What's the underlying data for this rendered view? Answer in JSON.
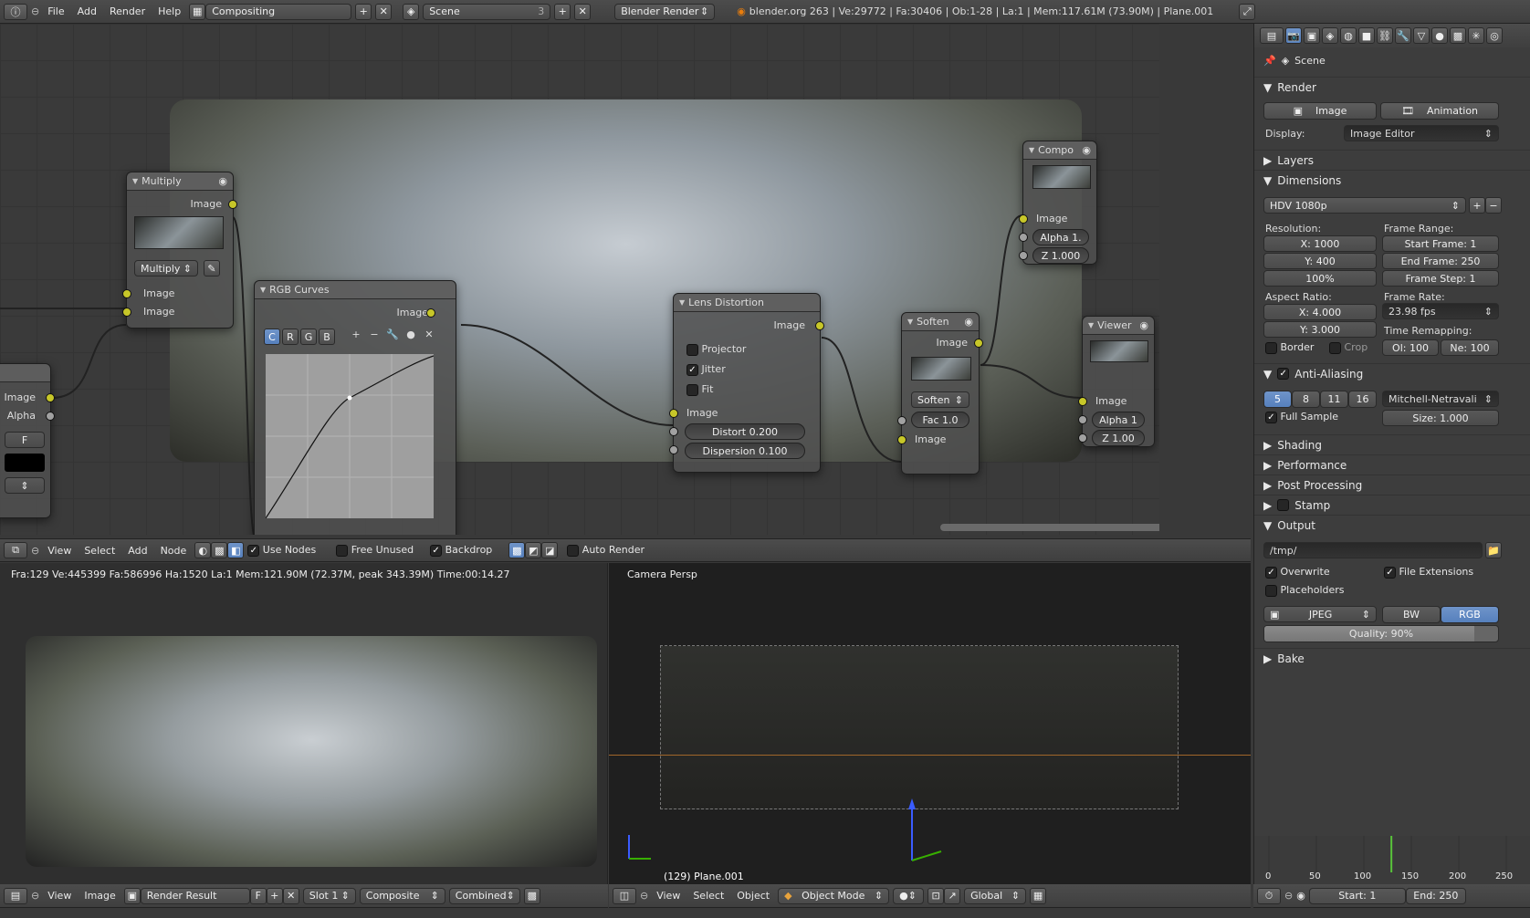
{
  "topbar": {
    "menus": [
      "File",
      "Add",
      "Render",
      "Help"
    ],
    "screen": "Compositing",
    "scene": "Scene",
    "scene_users": "3",
    "engine": "Blender Render",
    "stats": "blender.org 263 | Ve:29772 | Fa:30406 | Ob:1-28 | La:1 | Mem:117.61M (73.90M) | Plane.001"
  },
  "nodes": {
    "multiply": {
      "title": "Multiply",
      "out": "Image",
      "blend": "Multiply",
      "in1": "Image",
      "in2": "Image"
    },
    "left": {
      "out1": "Image",
      "out2": "Alpha",
      "f": "F"
    },
    "curves": {
      "title": "RGB Curves",
      "out": "Image",
      "tabs": [
        "C",
        "R",
        "G",
        "B"
      ]
    },
    "lens": {
      "title": "Lens Distortion",
      "out": "Image",
      "projector": "Projector",
      "jitter": "Jitter",
      "fit": "Fit",
      "in": "Image",
      "distort": "Distort 0.200",
      "dispersion": "Dispersion 0.100"
    },
    "compo": {
      "title": "Compo",
      "in": "Image",
      "alpha": "Alpha 1.",
      "z": "Z 1.000"
    },
    "soften": {
      "title": "Soften",
      "out": "Image",
      "type": "Soften",
      "fac": "Fac 1.0",
      "in": "Image"
    },
    "viewer": {
      "title": "Viewer",
      "in": "Image",
      "alpha": "Alpha 1",
      "z": "Z 1.00"
    }
  },
  "nodebar": {
    "menus": [
      "View",
      "Select",
      "Add",
      "Node"
    ],
    "use_nodes": "Use Nodes",
    "free_unused": "Free Unused",
    "backdrop": "Backdrop",
    "auto_render": "Auto Render"
  },
  "render_info": "Fra:129  Ve:445399 Fa:586996 Ha:1520 La:1 Mem:121.90M (72.37M, peak 343.39M) Time:00:14.27",
  "imgbar": {
    "menus": [
      "View",
      "Image"
    ],
    "image": "Render Result",
    "f": "F",
    "slot": "Slot 1",
    "layer": "Composite",
    "pass": "Combined"
  },
  "viewport": {
    "label": "Camera Persp",
    "object": "(129) Plane.001",
    "menus": [
      "View",
      "Select",
      "Object"
    ],
    "mode": "Object Mode",
    "orientation": "Global"
  },
  "props": {
    "scene": "Scene",
    "render": "Render",
    "image_btn": "Image",
    "anim_btn": "Animation",
    "display_label": "Display:",
    "display": "Image Editor",
    "layers": "Layers",
    "dimensions": "Dimensions",
    "preset": "HDV 1080p",
    "resolution": "Resolution:",
    "res_x": "X: 1000",
    "res_y": "Y: 400",
    "res_pct": "100%",
    "frame_range": "Frame Range:",
    "start": "Start Frame: 1",
    "end": "End Frame: 250",
    "step": "Frame Step: 1",
    "aspect": "Aspect Ratio:",
    "asp_x": "X: 4.000",
    "asp_y": "Y: 3.000",
    "frame_rate": "Frame Rate:",
    "fps": "23.98 fps",
    "time_remap": "Time Remapping:",
    "old": "Ol: 100",
    "new": "Ne: 100",
    "border": "Border",
    "crop": "Crop",
    "aa": "Anti-Aliasing",
    "aa_samples": [
      "5",
      "8",
      "11",
      "16"
    ],
    "filter": "Mitchell-Netravali",
    "full_sample": "Full Sample",
    "size": "Size: 1.000",
    "shading": "Shading",
    "performance": "Performance",
    "post": "Post Processing",
    "stamp": "Stamp",
    "output": "Output",
    "path": "/tmp/",
    "overwrite": "Overwrite",
    "file_ext": "File Extensions",
    "placeholders": "Placeholders",
    "format": "JPEG",
    "bw": "BW",
    "rgb": "RGB",
    "quality": "Quality: 90%",
    "bake": "Bake"
  },
  "timeline": {
    "ticks": [
      "0",
      "50",
      "100",
      "150",
      "200",
      "250"
    ],
    "start": "Start: 1",
    "end": "End: 250",
    "current_frame": 129
  }
}
